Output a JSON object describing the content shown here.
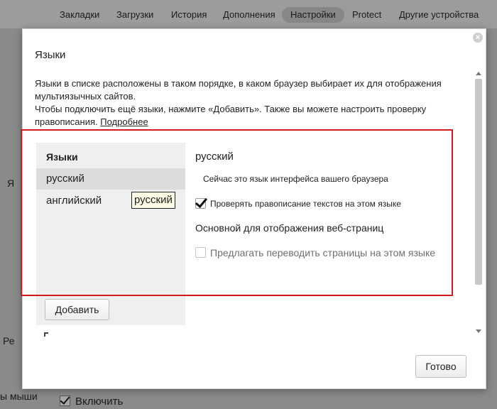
{
  "nav": {
    "tabs": [
      {
        "label": "Закладки"
      },
      {
        "label": "Загрузки"
      },
      {
        "label": "История"
      },
      {
        "label": "Дополнения"
      },
      {
        "label": "Настройки",
        "active": true
      },
      {
        "label": "Protect"
      },
      {
        "label": "Другие устройства"
      }
    ]
  },
  "background": {
    "fragment_1": "Я",
    "fragment_2": "Ре",
    "fragment_3": "ы мыши",
    "enable_label": "Включить"
  },
  "dialog": {
    "title": "Языки",
    "description_line1": "Языки в списке расположены в таком порядке, в каком браузер выбирает их для отображения мультиязычных сайтов.",
    "description_line2": "Чтобы подключить ещё языки, нажмите «Добавить». Также вы можете настроить проверку правописания.",
    "more_link": "Подробнее",
    "list_header": "Языки",
    "languages": [
      {
        "name": "русский",
        "selected": true
      },
      {
        "name": "английский",
        "selected": false
      }
    ],
    "drag_tooltip": "русский",
    "add_button": "Добавить",
    "details": {
      "language_name": "русский",
      "interface_note": "Сейчас это язык интерфейса вашего браузера",
      "spellcheck_label": "Проверять правописание текстов на этом языке",
      "spellcheck_checked": true,
      "primary_button": "Основной для отображения веб-страниц",
      "translate_label": "Предлагать переводить страницы на этом языке",
      "translate_checked": false
    },
    "done_button": "Готово",
    "close_icon": "close-icon"
  },
  "colors": {
    "highlight": "#d11a1a",
    "overlay": "#8a8a8a",
    "list_bg": "#efefef",
    "selected_bg": "#dcdcdc"
  }
}
